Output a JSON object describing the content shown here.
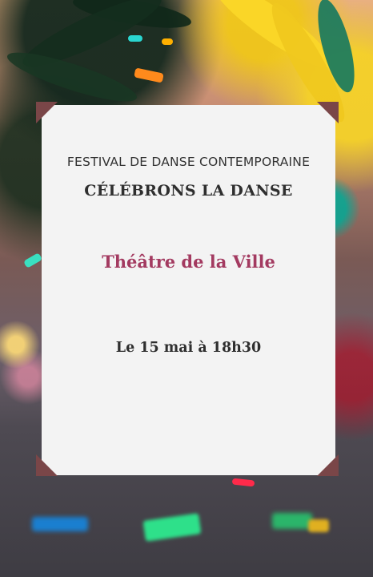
{
  "poster": {
    "festival_label": "FESTIVAL DE DANSE CONTEMPORAINE",
    "headline": "CÉLÉBRONS LA DANSE",
    "venue": "Théâtre de la Ville",
    "date_time": "Le 15 mai à 18h30"
  },
  "colors": {
    "card_background": "#f3f3f3",
    "corner_accent": "#7a4648",
    "venue_text": "#a33a60",
    "body_text": "#2f2f2f"
  }
}
